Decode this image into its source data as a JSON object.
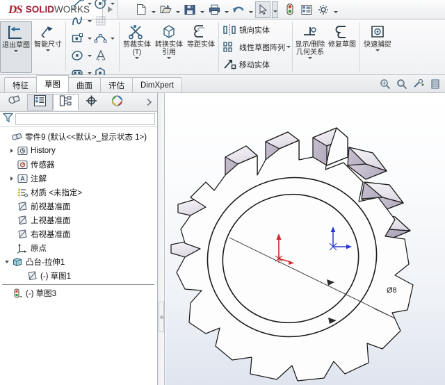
{
  "app": {
    "brand_ds": "DS",
    "brand_solid": "SOLID",
    "brand_works": "WORKS",
    "accent_color": "#9e1b2f"
  },
  "quick_access": {
    "items": [
      {
        "name": "new-document",
        "icon": "new-file-icon",
        "has_caret": true
      },
      {
        "name": "open-document",
        "icon": "open-folder-icon",
        "has_caret": true
      },
      {
        "name": "save-document",
        "icon": "save-disk-icon",
        "has_caret": true
      },
      {
        "name": "print-document",
        "icon": "printer-icon",
        "has_caret": true
      },
      {
        "name": "undo",
        "icon": "undo-arrow-icon",
        "has_caret": true
      },
      {
        "name": "select",
        "icon": "cursor-arrow-icon",
        "has_caret": true,
        "selected": true
      },
      {
        "name": "rebuild",
        "icon": "traffic-light-icon",
        "has_caret": false
      },
      {
        "name": "options-list",
        "icon": "list-properties-icon",
        "has_caret": false
      },
      {
        "name": "options",
        "icon": "gear-icon",
        "has_caret": true
      }
    ]
  },
  "ribbon": {
    "exit_sketch": {
      "label": "退出草图",
      "icon": "exit-sketch-icon"
    },
    "smart_dimension": {
      "label": "智能尺寸",
      "icon": "smart-dimension-icon"
    },
    "sketch_entities": [
      {
        "name": "line",
        "icon": "line-icon",
        "caret": true
      },
      {
        "name": "circle",
        "icon": "circle-icon",
        "caret": true
      },
      {
        "name": "spline",
        "icon": "spline-icon",
        "caret": true
      },
      {
        "name": "surface-grid",
        "icon": "grid-surface-icon",
        "caret": false
      },
      {
        "name": "rectangle",
        "icon": "rectangle-icon",
        "caret": true
      },
      {
        "name": "arc",
        "icon": "arc-icon",
        "caret": true
      },
      {
        "name": "ellipse",
        "icon": "ellipse-icon",
        "caret": true
      },
      {
        "name": "text",
        "icon": "text-a-icon",
        "caret": false
      },
      {
        "name": "slot",
        "icon": "slot-icon",
        "caret": true
      },
      {
        "name": "polygon",
        "icon": "polygon-icon",
        "caret": false
      },
      {
        "name": "sketch-fillet",
        "icon": "sketch-fillet-icon",
        "caret": true
      },
      {
        "name": "point",
        "icon": "point-icon",
        "caret": false
      }
    ],
    "trim_entities": {
      "label": "剪裁实体(T)",
      "icon": "trim-entities-icon"
    },
    "convert_entities": {
      "label": "转换实体引用",
      "icon": "convert-entities-icon"
    },
    "offset_entities": {
      "label": "等距实体",
      "icon": "offset-entities-icon"
    },
    "tools": [
      {
        "label": "镜向实体",
        "icon": "mirror-entities-icon"
      },
      {
        "label": "线性草图阵列",
        "icon": "linear-pattern-icon"
      },
      {
        "label": "移动实体",
        "icon": "move-entities-icon"
      }
    ],
    "display_delete_relations": {
      "label": "显示/删除几何关系",
      "icon": "display-relations-icon"
    },
    "repair_sketch": {
      "label": "修复草图",
      "icon": "repair-sketch-icon"
    },
    "quick_snaps": {
      "label": "快速捕捉",
      "icon": "quick-snap-icon"
    }
  },
  "tabs": {
    "items": [
      {
        "label": "特征",
        "selected": false
      },
      {
        "label": "草图",
        "selected": true
      },
      {
        "label": "曲面",
        "selected": false
      },
      {
        "label": "评估",
        "selected": false
      },
      {
        "label": "DimXpert",
        "selected": false
      }
    ],
    "view_tools": [
      {
        "name": "zoom-to-fit-icon"
      },
      {
        "name": "zoom-to-area-icon"
      },
      {
        "name": "zoom-in-out-icon"
      },
      {
        "name": "section-view-icon"
      }
    ]
  },
  "panel": {
    "tabs": [
      {
        "name": "feature-manager-tab",
        "icon": "feature-tree-icon",
        "state": "normal"
      },
      {
        "name": "property-manager-tab",
        "icon": "property-list-icon",
        "state": "on"
      },
      {
        "name": "configuration-manager-tab",
        "icon": "configuration-icon",
        "state": "sel"
      },
      {
        "name": "dimxpert-manager-tab",
        "icon": "dimxpert-target-icon",
        "state": "normal"
      },
      {
        "name": "display-manager-tab",
        "icon": "display-palette-icon",
        "state": "normal"
      }
    ],
    "filter_icon": "filter-funnel-icon",
    "filter_value": "",
    "filter_placeholder": ""
  },
  "tree": {
    "root": {
      "label": "零件9  (默认<<默认>_显示状态 1>)",
      "icon": "part-icon"
    },
    "items": [
      {
        "label": "History",
        "icon": "history-icon",
        "expandable": true,
        "indent": 1
      },
      {
        "label": "传感器",
        "icon": "sensor-icon",
        "expandable": false,
        "indent": 1
      },
      {
        "label": "注解",
        "icon": "annotations-icon",
        "expandable": true,
        "indent": 1
      },
      {
        "label": "材质 <未指定>",
        "icon": "material-icon",
        "expandable": false,
        "indent": 1
      },
      {
        "label": "前视基准面",
        "icon": "plane-icon",
        "expandable": false,
        "indent": 1
      },
      {
        "label": "上视基准面",
        "icon": "plane-icon",
        "expandable": false,
        "indent": 1
      },
      {
        "label": "右视基准面",
        "icon": "plane-icon",
        "expandable": false,
        "indent": 1
      },
      {
        "label": "原点",
        "icon": "origin-icon",
        "expandable": false,
        "indent": 1
      },
      {
        "label": "凸台-拉伸1",
        "icon": "extrude-boss-icon",
        "expandable": true,
        "expanded": true,
        "indent": 1
      },
      {
        "label": "(-) 草图1",
        "icon": "sketch-icon",
        "expandable": false,
        "indent": 2
      }
    ],
    "after_rollback": [
      {
        "label": "(-) 草图3",
        "icon": "active-sketch-icon",
        "expandable": false,
        "indent": 1
      }
    ]
  },
  "viewport": {
    "dimension_label": "Ø8",
    "model_name": "spur-gear",
    "teeth_count": 14,
    "background_top": "#ffffff",
    "background_bottom": "#dfe4ee",
    "face_light": "#f3f2f5",
    "face_mid": "#c8c3ce",
    "face_dark": "#a9a2b3",
    "edge_color": "#1a1a1a",
    "origin_red": "#d12b2b",
    "origin_blue": "#2538cf"
  }
}
